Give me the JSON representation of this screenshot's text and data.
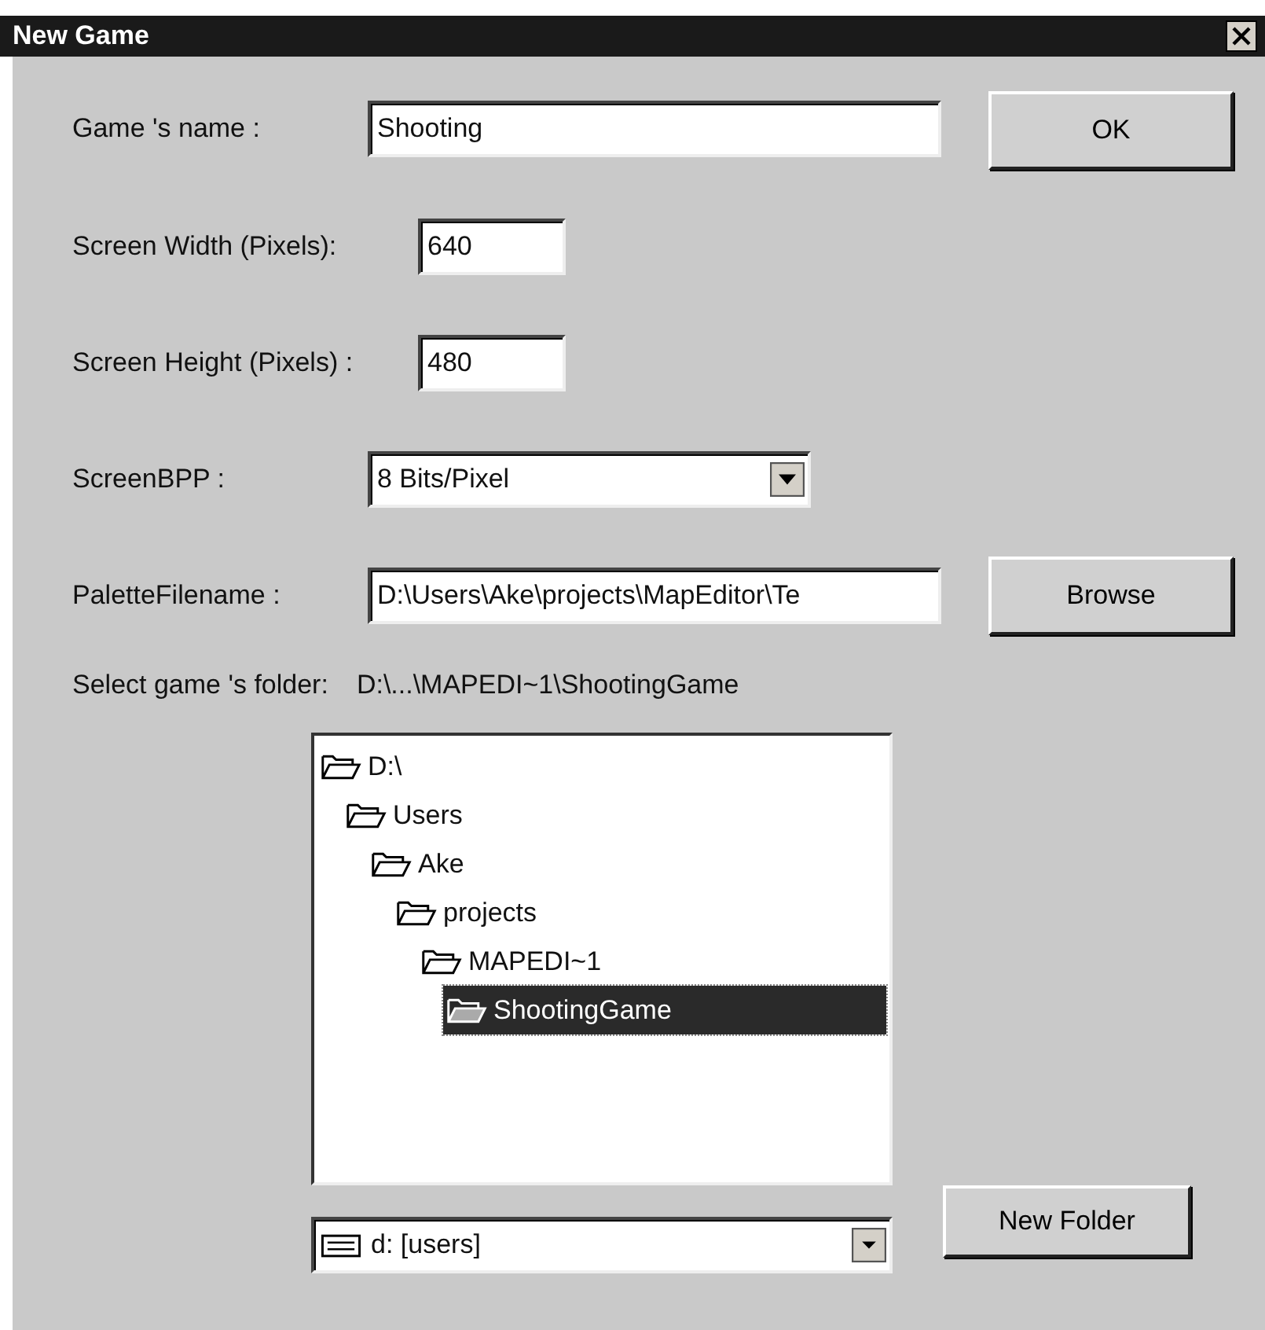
{
  "window": {
    "title": "New Game"
  },
  "name_field": {
    "label": "Game 's name :",
    "value": "Shooting"
  },
  "ok_button": "OK",
  "width_field": {
    "label": "Screen Width (Pixels):",
    "value": "640"
  },
  "height_field": {
    "label": "Screen Height (Pixels) :",
    "value": "480"
  },
  "bpp_dropdown": {
    "label": "ScreenBPP :",
    "value": "8 Bits/Pixel"
  },
  "palette_field": {
    "label": "PaletteFilename :",
    "value": "D:\\Users\\Ake\\projects\\MapEditor\\Te"
  },
  "browse_button": "Browse",
  "folder": {
    "label": "Select game 's folder:",
    "path": "D:\\...\\MAPEDI~1\\ShootingGame"
  },
  "folder_tree": [
    {
      "label": "D:\\",
      "selected": false,
      "children": [
        {
          "label": "Users",
          "selected": false,
          "children": [
            {
              "label": "Ake",
              "selected": false,
              "children": [
                {
                  "label": "projects",
                  "selected": false,
                  "children": [
                    {
                      "label": "MAPEDI~1",
                      "selected": false,
                      "children": [
                        {
                          "label": "ShootingGame",
                          "selected": true
                        }
                      ]
                    }
                  ]
                }
              ]
            }
          ]
        }
      ]
    }
  ],
  "drive_dropdown": {
    "value": "d: [users]"
  },
  "new_folder_button": "New Folder"
}
